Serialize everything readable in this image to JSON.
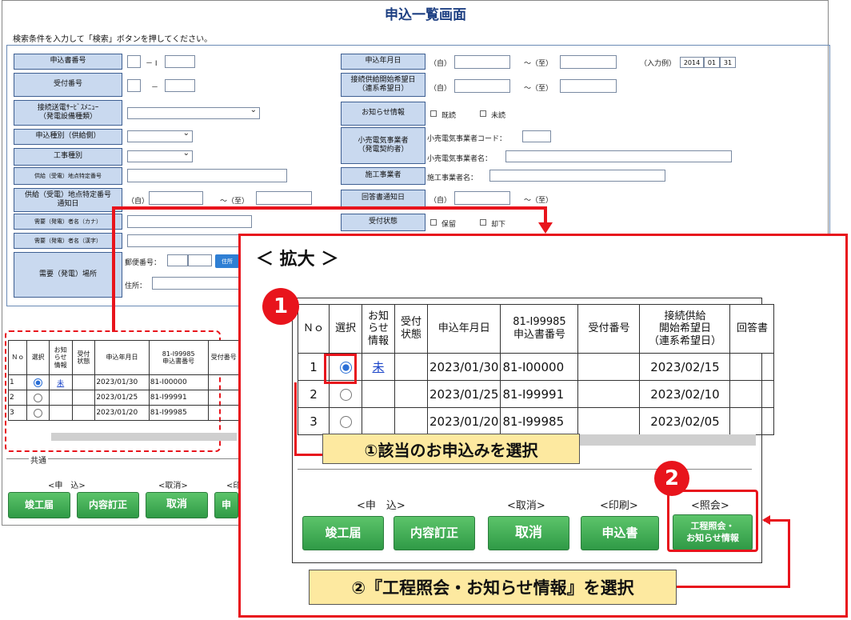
{
  "page": {
    "title": "申込一覧画面",
    "instruction": "検索条件を入力して「検索」ボタンを押してください。"
  },
  "search": {
    "left": [
      {
        "label": "申込書番号",
        "sep": "－ I"
      },
      {
        "label": "受付番号",
        "sep": "－"
      },
      {
        "label": "接続送電ｻｰﾋﾞｽﾒﾆｭｰ\n（発電設備種類）"
      },
      {
        "label": "申込種別（供給側）"
      },
      {
        "label": "工事種別"
      },
      {
        "label": "供給（受電）地点特定番号"
      },
      {
        "label": "供給（受電）地点特定番号\n通知日",
        "from": "（自）",
        "to": "～（至）"
      },
      {
        "label": "需要（発電）者名（カナ）"
      },
      {
        "label": "需要（発電）者名（漢字）"
      },
      {
        "label": "需要（発電）場所",
        "postal": "郵便番号：",
        "address": "住所：",
        "addr_btn": "住所"
      }
    ],
    "right": [
      {
        "label": "申込年月日",
        "from": "（自）",
        "to": "～（至）",
        "example_label": "（入力例）",
        "example": [
          "2014",
          "01",
          "31"
        ]
      },
      {
        "label": "接続供給開始希望日\n（連系希望日）",
        "from": "（自）",
        "to": "～（至）"
      },
      {
        "label": "お知らせ情報",
        "opt1": "既読",
        "opt2": "未読"
      },
      {
        "label": "小売電気事業者\n（発電契約者）",
        "code_label": "小売電気事業者コード：",
        "name_label": "小売電気事業者名："
      },
      {
        "label": "施工事業者",
        "name_label": "施工事業者名："
      },
      {
        "label": "回答書通知日",
        "from": "（自）",
        "to": "～（至）"
      },
      {
        "label": "受付状態",
        "opt1": "保留",
        "opt2": "却下"
      }
    ]
  },
  "table": {
    "headers": [
      "Ｎｏ",
      "選択",
      "お知らせ情報",
      "受付状態",
      "申込年月日",
      "81-I99985\n申込書番号",
      "受付番号",
      "接続供給開始希望日（連系希望日）",
      "回答書"
    ],
    "headers_small": [
      "Ｎｏ",
      "選択",
      "お知\nらせ\n情報",
      "受付\n状態",
      "申込年月日",
      "81-I99985\n申込書番号",
      "受付番号"
    ],
    "headers_big": [
      "Ｎｏ",
      "選択",
      "お知\nらせ\n情報",
      "受付\n状態",
      "申込年月日",
      "81-I99985\n申込書番号",
      "受付番号",
      "接続供給\n開始希望日\n（連系希望日）",
      "回答書"
    ],
    "rows": [
      {
        "no": "1",
        "selected": true,
        "notice": "未",
        "status": "",
        "date": "2023/01/30",
        "app_no": "81-I00000",
        "recv_no": "",
        "start": "2023/02/15"
      },
      {
        "no": "2",
        "selected": false,
        "notice": "",
        "status": "",
        "date": "2023/01/25",
        "app_no": "81-I99991",
        "recv_no": "",
        "start": "2023/02/10"
      },
      {
        "no": "3",
        "selected": false,
        "notice": "",
        "status": "",
        "date": "2023/01/20",
        "app_no": "81-I99985",
        "recv_no": "",
        "start": "2023/02/05"
      }
    ]
  },
  "common": {
    "label": "共通",
    "groups_small": [
      "<申　込>",
      "<取消>",
      "<印"
    ],
    "buttons_small": [
      "竣工届",
      "内容訂正",
      "取消",
      "申"
    ],
    "groups_big": [
      "<申　込>",
      "<取消>",
      "<印刷>",
      "<照会>"
    ],
    "buttons_big": [
      "竣工届",
      "内容訂正",
      "取消",
      "申込書",
      "工程照会・\nお知らせ情報"
    ]
  },
  "zoom": {
    "title": "＜ 拡大 ＞",
    "step1_num": "1",
    "step1_text": "①該当のお申込みを選択",
    "step2_num": "2",
    "step2_text": "②『工程照会・お知らせ情報』を選択"
  },
  "colors": {
    "accent_red": "#e8141c",
    "label_bg": "#c9d9ef",
    "button_green": "#3aa84e",
    "callout_bg": "#fde9a0",
    "title_blue": "#1d3f82"
  }
}
